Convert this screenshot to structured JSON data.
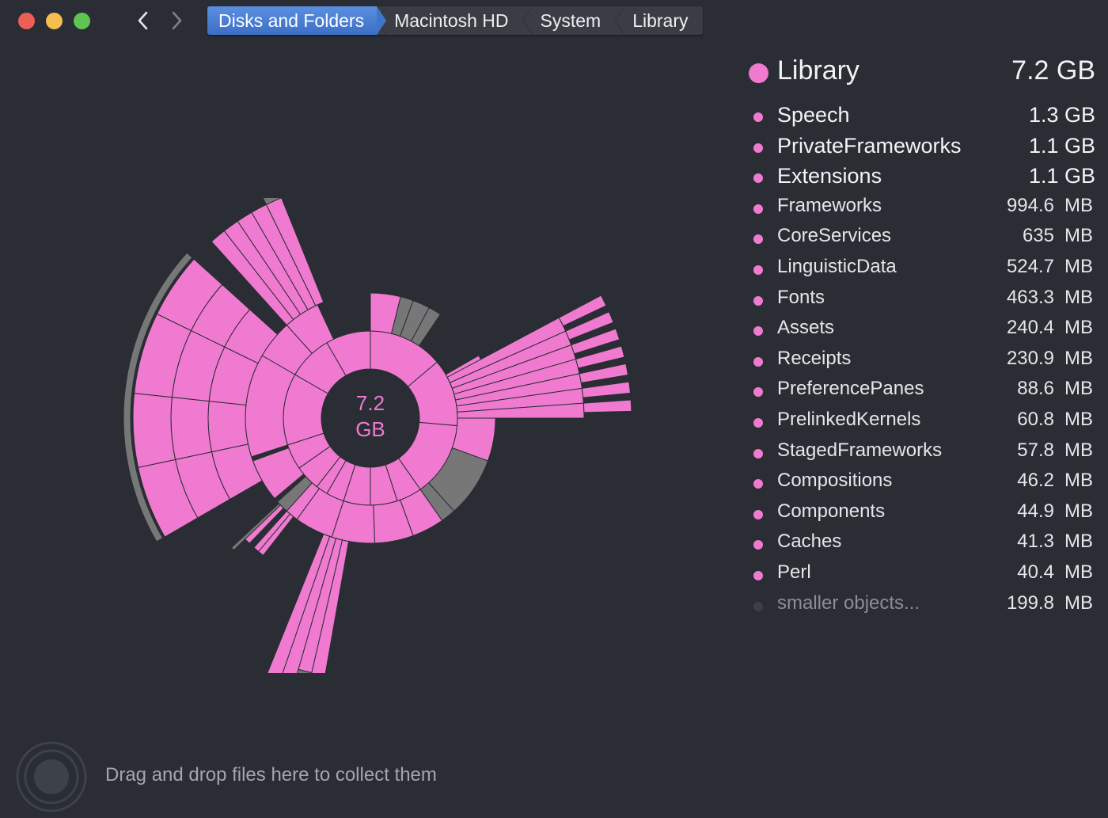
{
  "window": {
    "traffic_lights": {
      "close": "#ec5f57",
      "minimize": "#f4bf4f",
      "zoom": "#5fc454"
    },
    "nav": {
      "back_icon": "chevron-left-icon",
      "forward_icon": "chevron-right-icon"
    }
  },
  "breadcrumb": {
    "items": [
      "Disks and Folders",
      "Macintosh HD",
      "System",
      "Library"
    ],
    "active_index": 0,
    "active_color": "#4a80d8"
  },
  "chart": {
    "center_value": "7.2",
    "center_unit": "GB",
    "accent_color": "#f07ad0",
    "gray_color": "#777777",
    "inner_gray_color": "#3e4048"
  },
  "legend": {
    "header": {
      "name": "Library",
      "size": "7.2 GB"
    },
    "items": [
      {
        "name": "Speech",
        "num": "1.3",
        "unit": "GB"
      },
      {
        "name": "PrivateFrameworks",
        "num": "1.1",
        "unit": "GB"
      },
      {
        "name": "Extensions",
        "num": "1.1",
        "unit": "GB"
      },
      {
        "name": "Frameworks",
        "num": "994.6",
        "unit": "MB"
      },
      {
        "name": "CoreServices",
        "num": "635",
        "unit": "MB"
      },
      {
        "name": "LinguisticData",
        "num": "524.7",
        "unit": "MB"
      },
      {
        "name": "Fonts",
        "num": "463.3",
        "unit": "MB"
      },
      {
        "name": "Assets",
        "num": "240.4",
        "unit": "MB"
      },
      {
        "name": "Receipts",
        "num": "230.9",
        "unit": "MB"
      },
      {
        "name": "PreferencePanes",
        "num": "88.6",
        "unit": "MB"
      },
      {
        "name": "PrelinkedKernels",
        "num": "60.8",
        "unit": "MB"
      },
      {
        "name": "StagedFrameworks",
        "num": "57.8",
        "unit": "MB"
      },
      {
        "name": "Compositions",
        "num": "46.2",
        "unit": "MB"
      },
      {
        "name": "Components",
        "num": "44.9",
        "unit": "MB"
      },
      {
        "name": "Caches",
        "num": "41.3",
        "unit": "MB"
      },
      {
        "name": "Perl",
        "num": "40.4",
        "unit": "MB"
      },
      {
        "name": "smaller objects...",
        "num": "199.8",
        "unit": "MB"
      }
    ]
  },
  "dropzone": {
    "text": "Drag and drop files here to collect them",
    "icon": "collector-icon"
  }
}
